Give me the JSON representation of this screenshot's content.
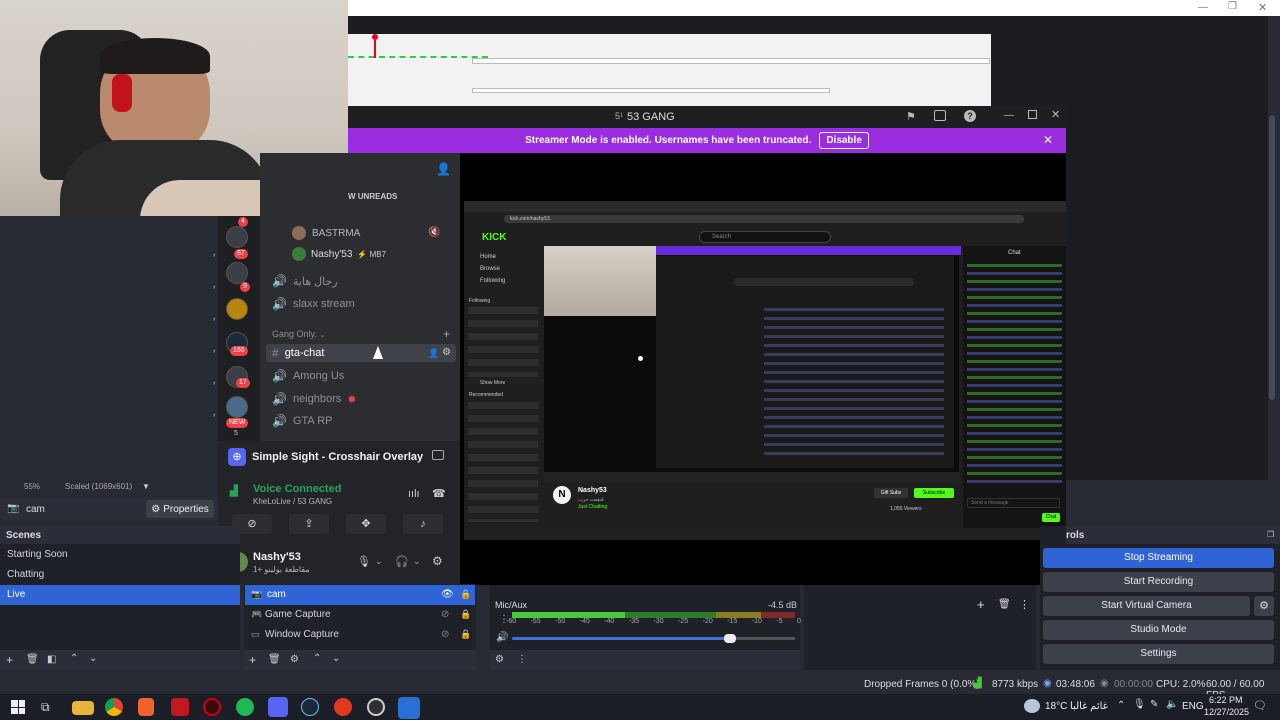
{
  "obs": {
    "zoom": "55%",
    "scaled": "Scaled (1069x601)",
    "source_name": "cam",
    "properties_label": "Properties",
    "scenes_title": "Scenes",
    "scenes": [
      "Starting Soon",
      "Chatting",
      "Live"
    ],
    "selected_scene": "Live",
    "sources": [
      "cam",
      "Game Capture",
      "Window Capture"
    ],
    "mixer": {
      "track": "Mic/Aux",
      "level": "-4.5 dB",
      "ticks": [
        "-60",
        "-55",
        "-50",
        "-45",
        "-40",
        "-35",
        "-30",
        "-25",
        "-20",
        "-15",
        "-10",
        "-5",
        "0"
      ],
      "volume_fraction": 0.77
    },
    "controls_title": "rols",
    "controls": [
      "Stop Streaming",
      "Start Recording",
      "Start Virtual Camera",
      "Studio Mode",
      "Settings"
    ],
    "status": {
      "dropped": "Dropped Frames 0 (0.0%)",
      "bitrate": "8773 kbps",
      "stream_time": "03:48:06",
      "rec_time": "00:00:00",
      "cpu": "CPU: 2.0%",
      "fps": "60.00 / 60.00 FPS"
    }
  },
  "discord": {
    "window_title": "53 GANG",
    "streamer_banner": "Streamer Mode is enabled. Usernames have been truncated.",
    "disable_label": "Disable",
    "unreads_label": "W UNREADS",
    "voice_users": [
      {
        "name": "BASTRMA",
        "tag": ""
      },
      {
        "name": "Nashy'53",
        "tag": "⚡ MB7"
      }
    ],
    "channels_top": [
      "رجال هاية",
      "slaxx stream"
    ],
    "category": "Gang Only.",
    "channels": [
      "gta-chat",
      "Among Us",
      "neighbors",
      "GTA RP"
    ],
    "server_badges": [
      "4",
      "87",
      "9",
      "166",
      "17",
      "NEW",
      "5"
    ],
    "activity": "Simple Sight - Crosshair Overlay",
    "voice_status": "Voice Connected",
    "voice_channel": "KheLoLive / 53 GANG",
    "user_name": "Nashy'53",
    "user_status": "1+ مقاطعة بولينو"
  },
  "kick": {
    "search_placeholder": "Search",
    "nav": [
      "Home",
      "Browse",
      "Following"
    ],
    "following_label": "Following",
    "recommended_label": "Recommended",
    "show_more": "Show More",
    "streamer": "Nashy53",
    "stream_sub": "قنقعت حرب",
    "category": "Just Chatting",
    "viewers": "1,055 Viewers",
    "gift_subs": "Gift Subs",
    "subscribe": "Subscribe",
    "chat_label": "Chat",
    "send_placeholder": "Send a message",
    "chat_button": "Chat",
    "url": "kick.com/nashy53",
    "brand": "KICK"
  },
  "taskbar": {
    "weather_temp": "18°C",
    "weather_desc": "غائم غالبا",
    "lang": "ENG",
    "time": "6:22 PM",
    "date": "12/27/2025"
  },
  "colors": {
    "discord_purple": "#5865f2",
    "streamer_banner": "#9b2de0",
    "obs_selected": "#2f64d6",
    "kick_green": "#53fc18",
    "meter_green": "#49c73a"
  }
}
